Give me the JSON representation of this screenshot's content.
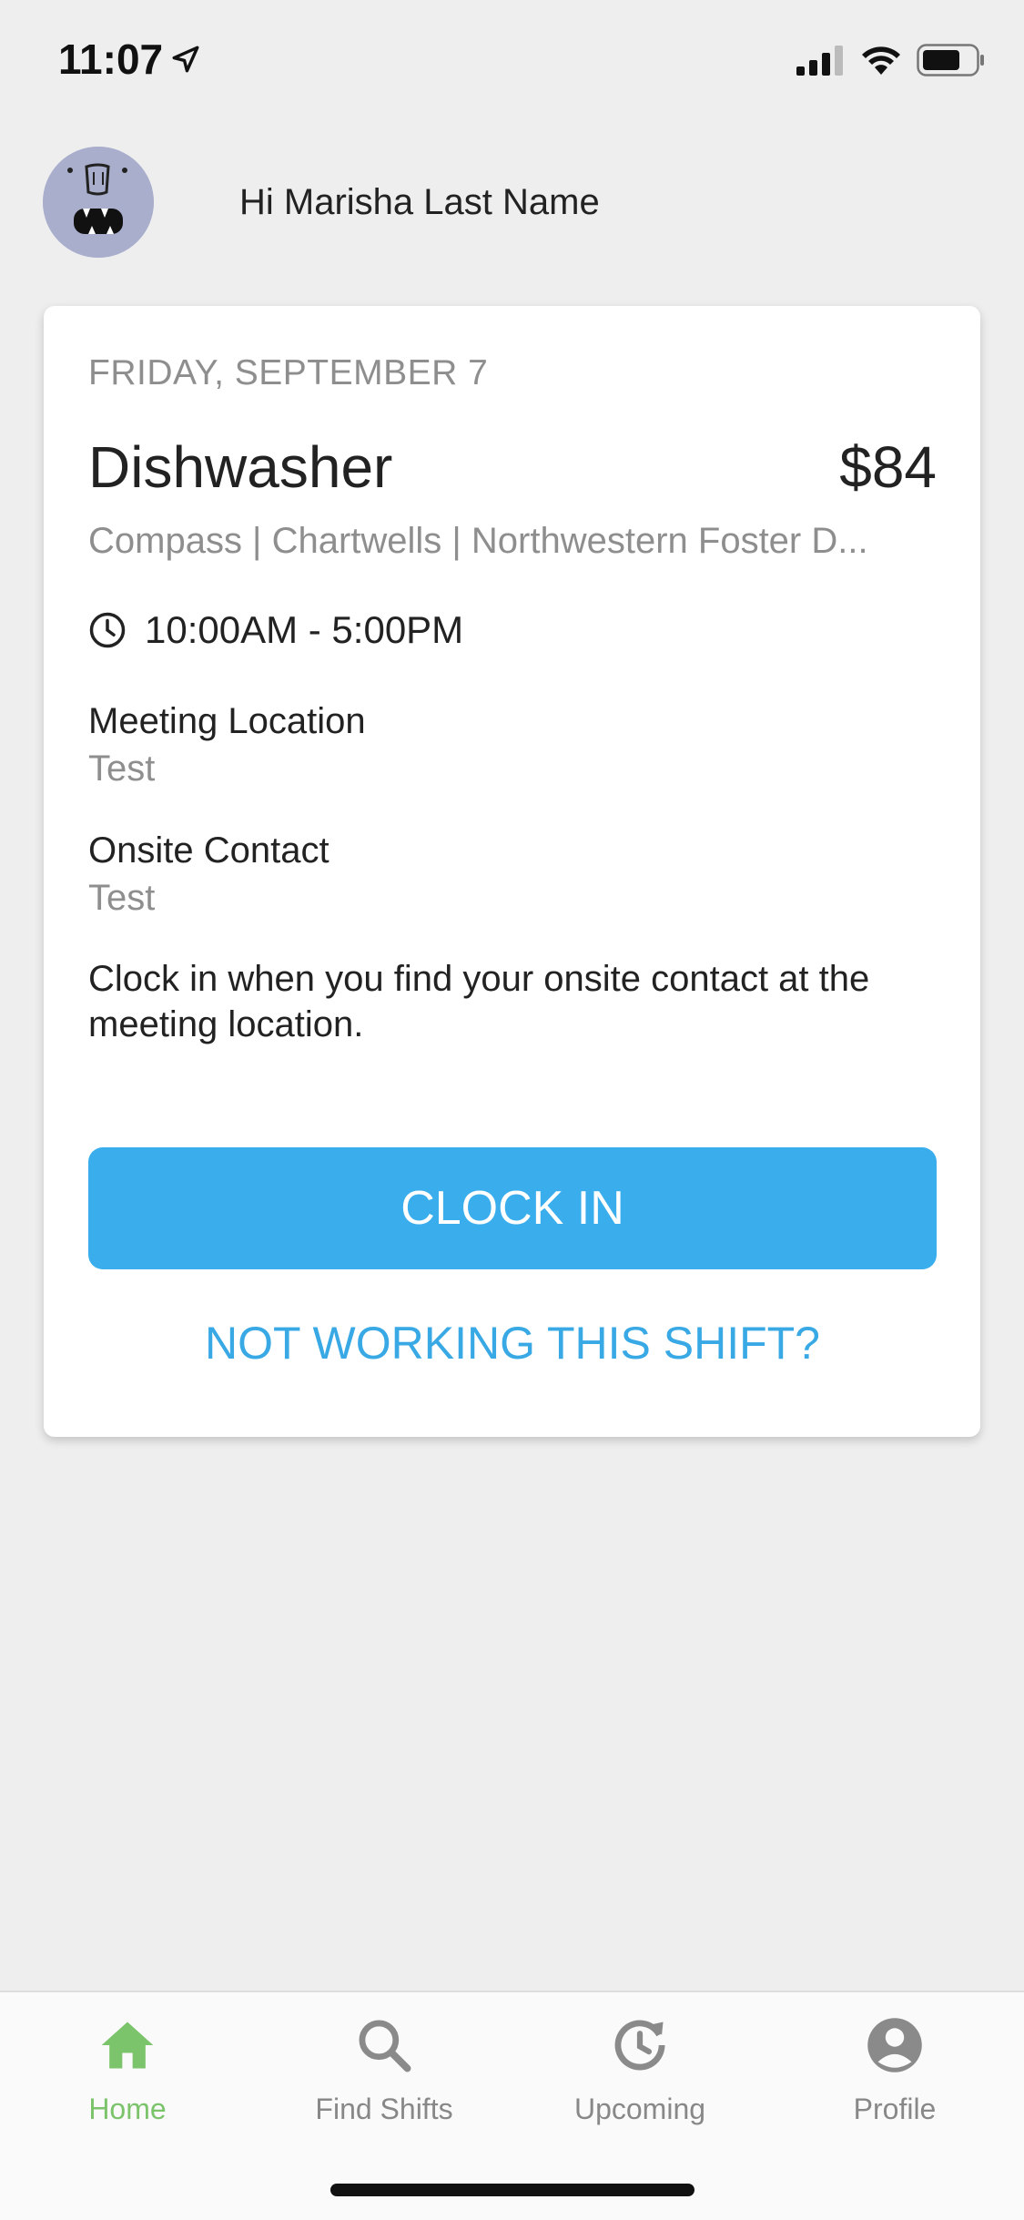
{
  "status_bar": {
    "time": "11:07",
    "icons": [
      "location-arrow-icon",
      "cellular-signal-icon",
      "wifi-icon",
      "battery-icon"
    ]
  },
  "greeting": {
    "text": "Hi Marisha Last Name",
    "avatar_icon": "monster-avatar"
  },
  "shift_card": {
    "date": "FRIDAY, SEPTEMBER 7",
    "title": "Dishwasher",
    "pay": "$84",
    "company": "Compass | Chartwells | Northwestern Foster D...",
    "time_range": "10:00AM - 5:00PM",
    "meeting_location_label": "Meeting Location",
    "meeting_location_value": "Test",
    "onsite_contact_label": "Onsite Contact",
    "onsite_contact_value": "Test",
    "instructions": "Clock in when you find your onsite contact at the meeting location.",
    "clock_in_label": "CLOCK IN",
    "not_working_label": "NOT WORKING THIS SHIFT?"
  },
  "tab_bar": {
    "tabs": [
      {
        "label": "Home",
        "icon": "home-icon",
        "active": true
      },
      {
        "label": "Find Shifts",
        "icon": "search-icon",
        "active": false
      },
      {
        "label": "Upcoming",
        "icon": "history-clock-icon",
        "active": false
      },
      {
        "label": "Profile",
        "icon": "profile-icon",
        "active": false
      }
    ]
  },
  "colors": {
    "accent_blue": "#3aaeed",
    "active_tab_green": "#7cc46b",
    "background": "#eeeeee",
    "muted_text": "#8e8e8e"
  }
}
